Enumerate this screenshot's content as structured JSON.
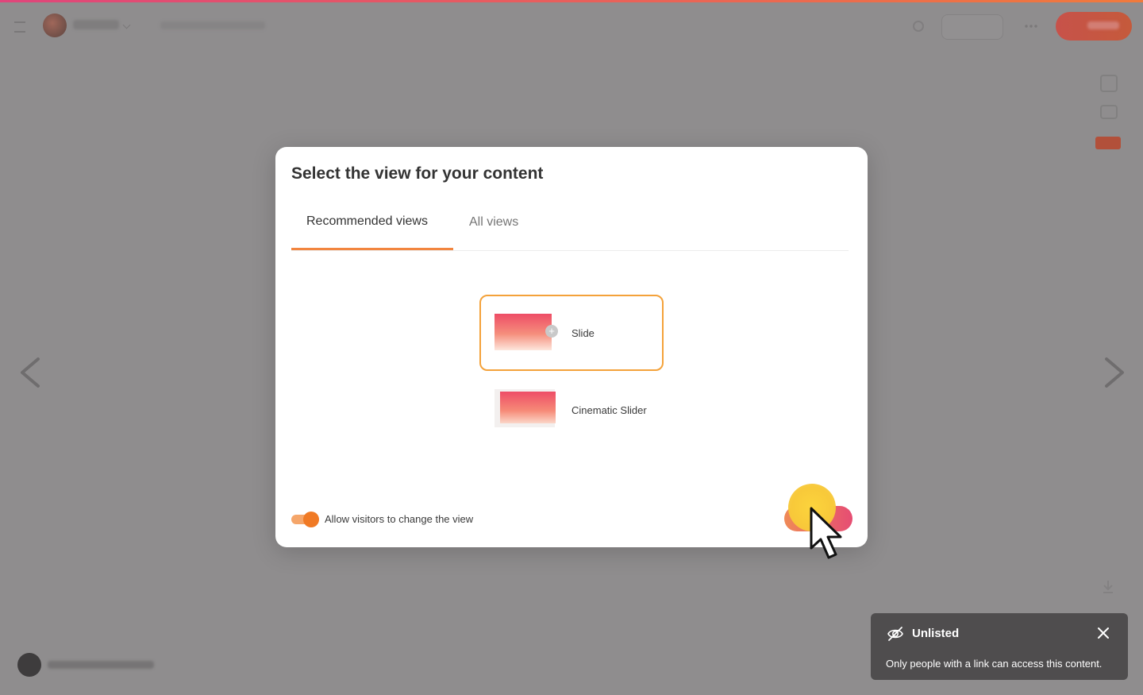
{
  "modal": {
    "title": "Select the view for your content",
    "tabs": [
      {
        "label": "Recommended views",
        "active": true
      },
      {
        "label": "All views",
        "active": false
      }
    ],
    "options": [
      {
        "label": "Slide",
        "selected": true
      },
      {
        "label": "Cinematic Slider",
        "selected": false
      }
    ],
    "toggle": {
      "label": "Allow visitors to change the view",
      "on": true
    }
  },
  "toast": {
    "title": "Unlisted",
    "message": "Only people with a link can access this content.",
    "icon": "eye-slash-icon"
  },
  "colors": {
    "accent": "#f2853f",
    "selected_border": "#f4a23a",
    "toggle": "#f07a25",
    "toast_bg": "#4f4d4e",
    "overlay": "#8f8d8e"
  }
}
